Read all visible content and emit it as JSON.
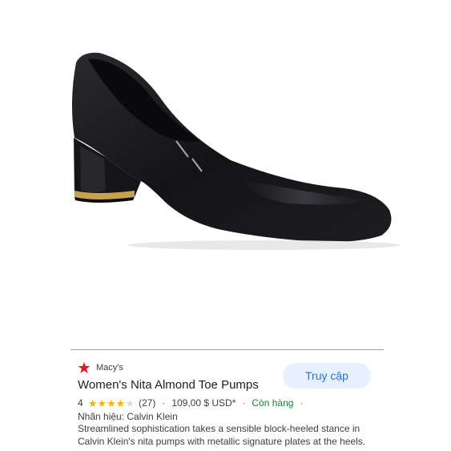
{
  "product_image": {
    "alt": "Black leather block-heel pump"
  },
  "colors": {
    "accent": "#1a73e8",
    "button_bg": "#e8f0fe",
    "rating_star": "#f4b400",
    "in_stock": "#188038",
    "store_star": "#e21a2c"
  },
  "result": {
    "store_icon": "star-icon",
    "store_name": "Macy's",
    "title": "Women's Nita Almond Toe Pumps",
    "visit_button": "Truy cập",
    "rating_value": "4",
    "rating_fraction": 0.8,
    "review_count": "(27)",
    "separator": "·",
    "price": "109,00 $ USD*",
    "availability": "Còn hàng",
    "brand_line": "Nhãn hiệu: Calvin Klein",
    "description": "Streamlined sophistication takes a sensible block-heeled stance in Calvin Klein's nita pumps with metallic signature plates at the heels."
  }
}
